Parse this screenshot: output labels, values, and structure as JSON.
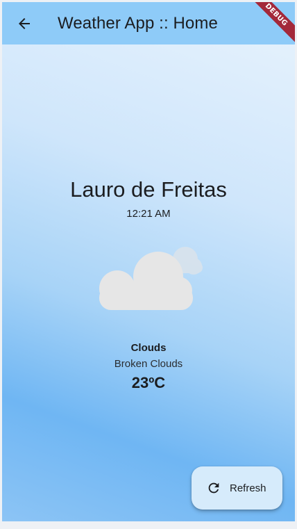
{
  "app_bar": {
    "title": "Weather App :: Home",
    "back_icon": "arrow-back-icon",
    "background_color": "#8ecbf8"
  },
  "debug_banner": {
    "label": "DEBUG",
    "color": "#a3283a"
  },
  "weather": {
    "city": "Lauro de Freitas",
    "time": "12:21 AM",
    "icon": "broken-clouds-icon",
    "condition": "Clouds",
    "description": "Broken Clouds",
    "temperature": "23ºC"
  },
  "refresh_button": {
    "label": "Refresh",
    "icon": "refresh-icon"
  }
}
